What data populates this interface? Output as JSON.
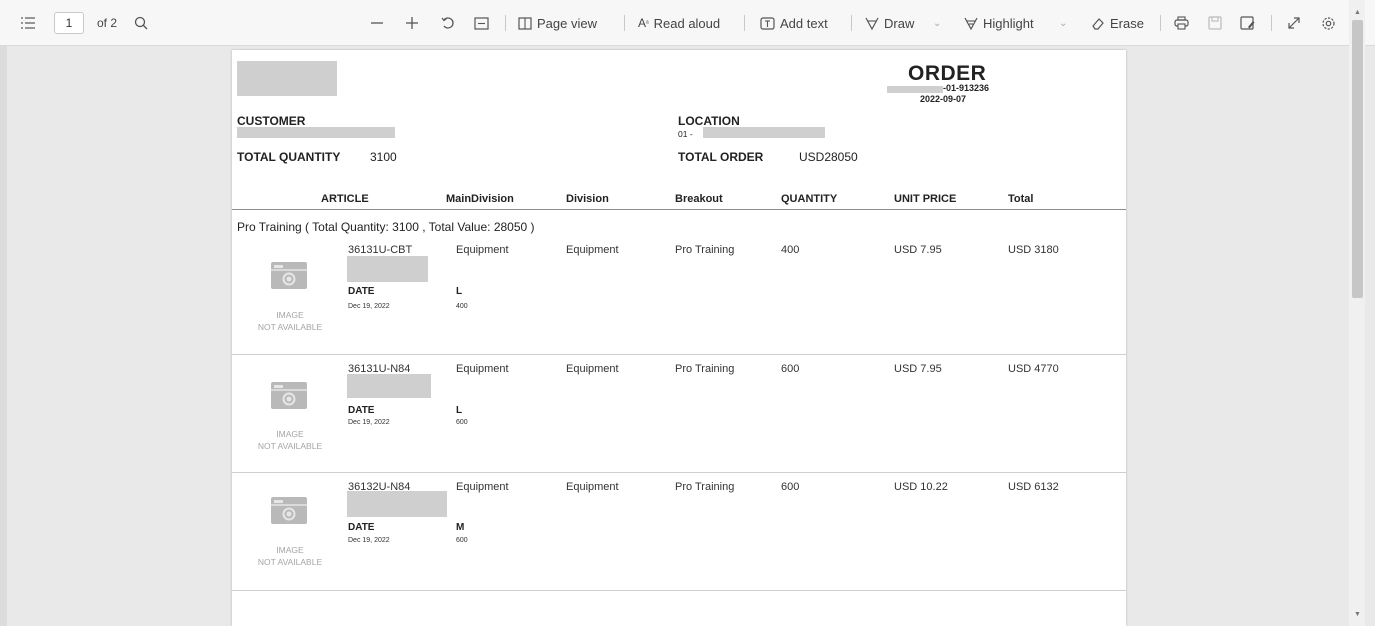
{
  "toolbar": {
    "page_current": "1",
    "page_total": "of 2",
    "page_view_label": "Page view",
    "read_aloud_label": "Read aloud",
    "add_text_label": "Add text",
    "draw_label": "Draw",
    "highlight_label": "Highlight",
    "erase_label": "Erase"
  },
  "document": {
    "order_title": "ORDER",
    "order_number": "-01-913236",
    "order_date": "2022-09-07",
    "customer_label": "CUSTOMER",
    "location_label": "LOCATION",
    "location_code": "01 -",
    "total_quantity_label": "TOTAL QUANTITY",
    "total_quantity_value": "3100",
    "total_order_label": "TOTAL ORDER",
    "total_order_value": "USD28050",
    "columns": [
      "ARTICLE",
      "MainDivision",
      "Division",
      "Breakout",
      "QUANTITY",
      "UNIT PRICE",
      "Total"
    ],
    "group_title": "Pro Training ( Total Quantity: 3100 , Total Value: 28050 )",
    "image_na_line1": "IMAGE",
    "image_na_line2": "NOT AVAILABLE",
    "date_label": "DATE",
    "items": [
      {
        "article": "36131U-CBT",
        "main_division": "Equipment",
        "division": "Equipment",
        "breakout": "Pro Training",
        "quantity": "400",
        "unit_price": "USD 7.95",
        "total": "USD 3180",
        "date": "Dec 19, 2022",
        "size": "L",
        "size_qty": "400"
      },
      {
        "article": "36131U-N84",
        "main_division": "Equipment",
        "division": "Equipment",
        "breakout": "Pro Training",
        "quantity": "600",
        "unit_price": "USD 7.95",
        "total": "USD 4770",
        "date": "Dec 19, 2022",
        "size": "L",
        "size_qty": "600"
      },
      {
        "article": "36132U-N84",
        "main_division": "Equipment",
        "division": "Equipment",
        "breakout": "Pro Training",
        "quantity": "600",
        "unit_price": "USD 10.22",
        "total": "USD 6132",
        "date": "Dec 19, 2022",
        "size": "M",
        "size_qty": "600"
      }
    ]
  }
}
